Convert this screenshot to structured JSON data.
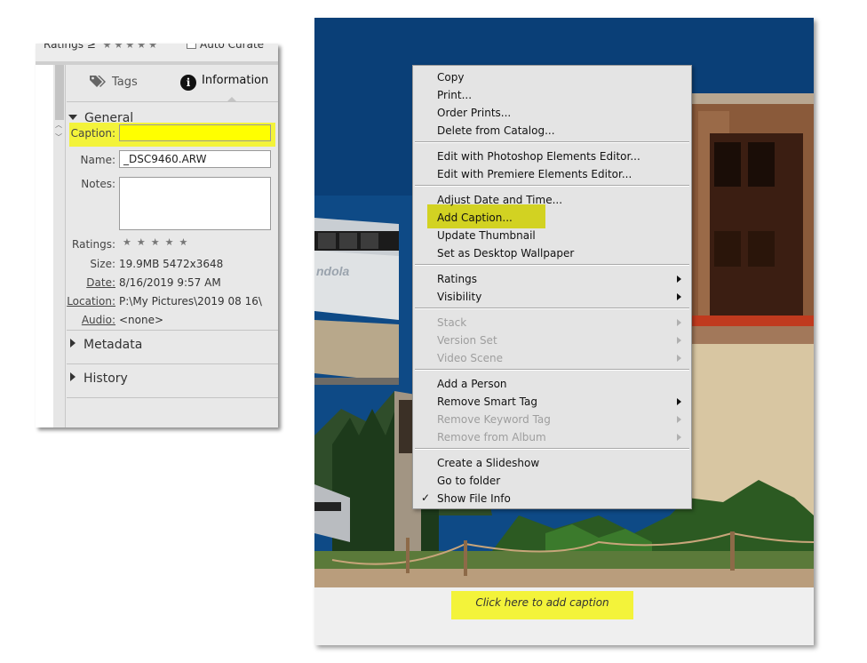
{
  "left_panel": {
    "rating_filter": {
      "label": "Ratings",
      "operator": "≥",
      "stars": "★★★★★"
    },
    "auto_curate": {
      "label": "Auto Curate",
      "checked": false
    },
    "tabs": {
      "tags": "Tags",
      "information": "Information",
      "active": "Information"
    },
    "general": {
      "heading": "General",
      "caption_label": "Caption:",
      "caption_value": "",
      "name_label": "Name:",
      "name_value": "_DSC9460.ARW",
      "notes_label": "Notes:",
      "notes_value": "",
      "ratings_label": "Ratings:",
      "ratings_stars": "★★★★★",
      "size_label": "Size:",
      "size_value": "19.9MB  5472x3648",
      "date_label": "Date:",
      "date_value": "8/16/2019 9:57 AM",
      "location_label": "Location:",
      "location_value": "P:\\My Pictures\\2019 08 16\\",
      "audio_label": "Audio:",
      "audio_value": "<none>"
    },
    "metadata_heading": "Metadata",
    "history_heading": "History",
    "highlight_color": "#f3f33a"
  },
  "photo": {
    "sign_text": "ndola",
    "caption_placeholder": "Click here to add caption",
    "sky_color": "#0d4a86",
    "highlight_color": "#f3f33a"
  },
  "context_menu": {
    "items": [
      {
        "label": "Copy"
      },
      {
        "label": "Print..."
      },
      {
        "label": "Order Prints..."
      },
      {
        "label": "Delete from Catalog..."
      },
      {
        "label": "Edit with Photoshop Elements Editor..."
      },
      {
        "label": "Edit with Premiere Elements Editor..."
      },
      {
        "label": "Adjust Date and Time..."
      },
      {
        "label": "Add Caption...",
        "highlighted": true
      },
      {
        "label": "Update Thumbnail"
      },
      {
        "label": "Set as Desktop Wallpaper"
      },
      {
        "label": "Ratings",
        "submenu": true
      },
      {
        "label": "Visibility",
        "submenu": true
      },
      {
        "label": "Stack",
        "submenu": true,
        "disabled": true
      },
      {
        "label": "Version Set",
        "submenu": true,
        "disabled": true
      },
      {
        "label": "Video Scene",
        "submenu": true,
        "disabled": true
      },
      {
        "label": "Add a Person"
      },
      {
        "label": "Remove Smart Tag",
        "submenu": true
      },
      {
        "label": "Remove Keyword Tag",
        "submenu": true,
        "disabled": true
      },
      {
        "label": "Remove from Album",
        "submenu": true,
        "disabled": true
      },
      {
        "label": "Create a Slideshow"
      },
      {
        "label": "Go to folder"
      },
      {
        "label": "Show File Info",
        "checked": true
      }
    ]
  }
}
